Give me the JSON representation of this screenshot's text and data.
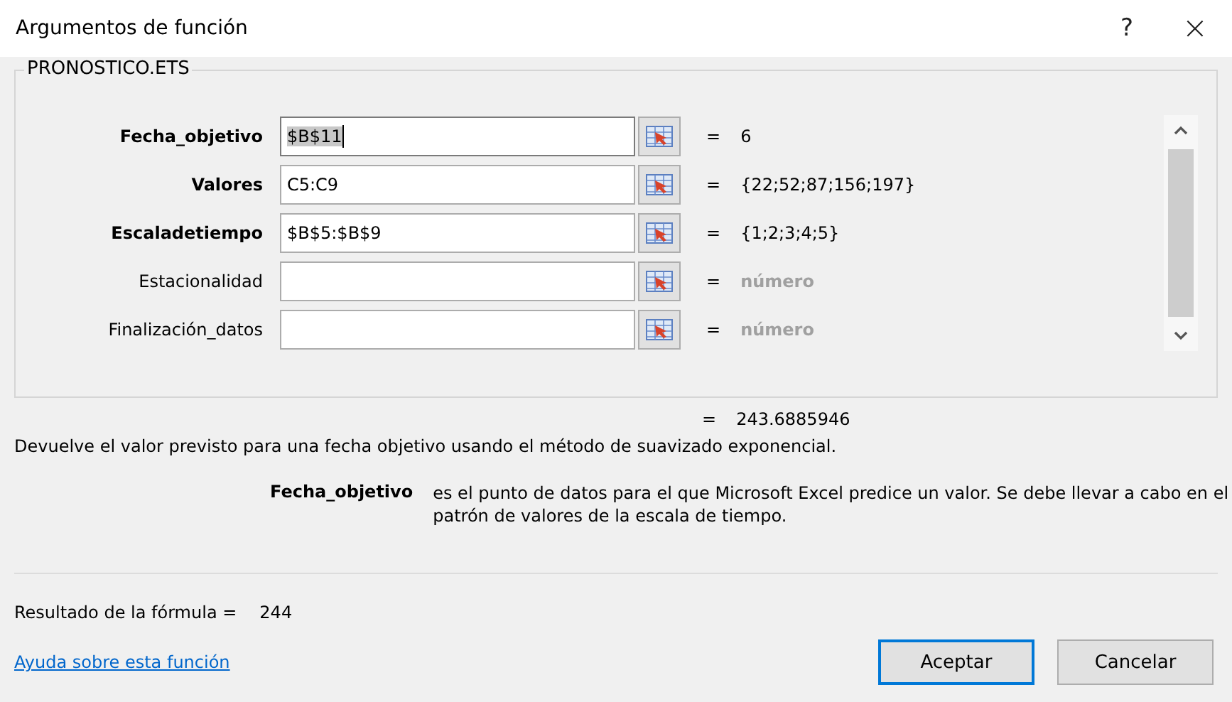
{
  "window": {
    "title": "Argumentos de función",
    "help": "?",
    "close": "×"
  },
  "function_name": "PRONOSTICO.ETS",
  "arguments": [
    {
      "label": "Fecha_objetivo",
      "required": true,
      "value": "$B$11",
      "text_selected": true,
      "equals": "=",
      "result": "6",
      "result_hint": false
    },
    {
      "label": "Valores",
      "required": true,
      "value": "C5:C9",
      "text_selected": false,
      "equals": "=",
      "result": "{22;52;87;156;197}",
      "result_hint": false
    },
    {
      "label": "Escaladetiempo",
      "required": true,
      "value": "$B$5:$B$9",
      "text_selected": false,
      "equals": "=",
      "result": "{1;2;3;4;5}",
      "result_hint": false
    },
    {
      "label": "Estacionalidad",
      "required": false,
      "text_selected": false,
      "equals": "=",
      "result": "número",
      "result_hint": true
    },
    {
      "label": "Finalización_datos",
      "required": false,
      "text_selected": false,
      "equals": "=",
      "result": "número",
      "result_hint": true
    }
  ],
  "function_result": {
    "equals": "=",
    "value": "243.6885946"
  },
  "description": "Devuelve el valor previsto para una fecha objetivo usando el método de suavizado exponencial.",
  "argument_help": {
    "name": "Fecha_objetivo",
    "text": "es el punto de datos para el que Microsoft Excel predice un valor. Se debe llevar a cabo en el patrón de valores de la escala de tiempo."
  },
  "formula_result": {
    "label": "Resultado de la fórmula =",
    "value": "244"
  },
  "help_link": "Ayuda sobre esta función",
  "buttons": [
    {
      "label": "Aceptar",
      "default": true
    },
    {
      "label": "Cancelar",
      "default": false
    }
  ]
}
